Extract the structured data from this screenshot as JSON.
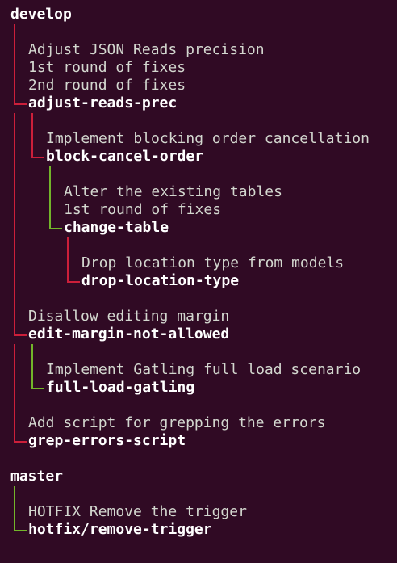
{
  "colors": {
    "background": "#300a24",
    "text": "#eeeeec",
    "rail_red": "#cc1f3a",
    "rail_green": "#73b52a"
  },
  "trees": [
    {
      "root": "develop",
      "adjust": {
        "commits": [
          "Adjust JSON Reads precision",
          "1st round of fixes",
          "2nd round of fixes"
        ],
        "branch": "adjust-reads-prec"
      },
      "block": {
        "commits": [
          "Implement blocking order cancellation"
        ],
        "branch": "block-cancel-order"
      },
      "change": {
        "commits": [
          "Alter the existing tables",
          "1st round of fixes"
        ],
        "branch": "change-table"
      },
      "drop": {
        "commits": [
          "Drop location type from models"
        ],
        "branch": "drop-location-type"
      },
      "edit": {
        "commits": [
          "Disallow editing margin"
        ],
        "branch": "edit-margin-not-allowed"
      },
      "gatling": {
        "commits": [
          "Implement Gatling full load scenario"
        ],
        "branch": "full-load-gatling"
      },
      "grep": {
        "commits": [
          "Add script for grepping the errors"
        ],
        "branch": "grep-errors-script"
      }
    },
    {
      "root": "master",
      "hotfix": {
        "commits": [
          "HOTFIX Remove the trigger"
        ],
        "branch": "hotfix/remove-trigger"
      }
    }
  ]
}
